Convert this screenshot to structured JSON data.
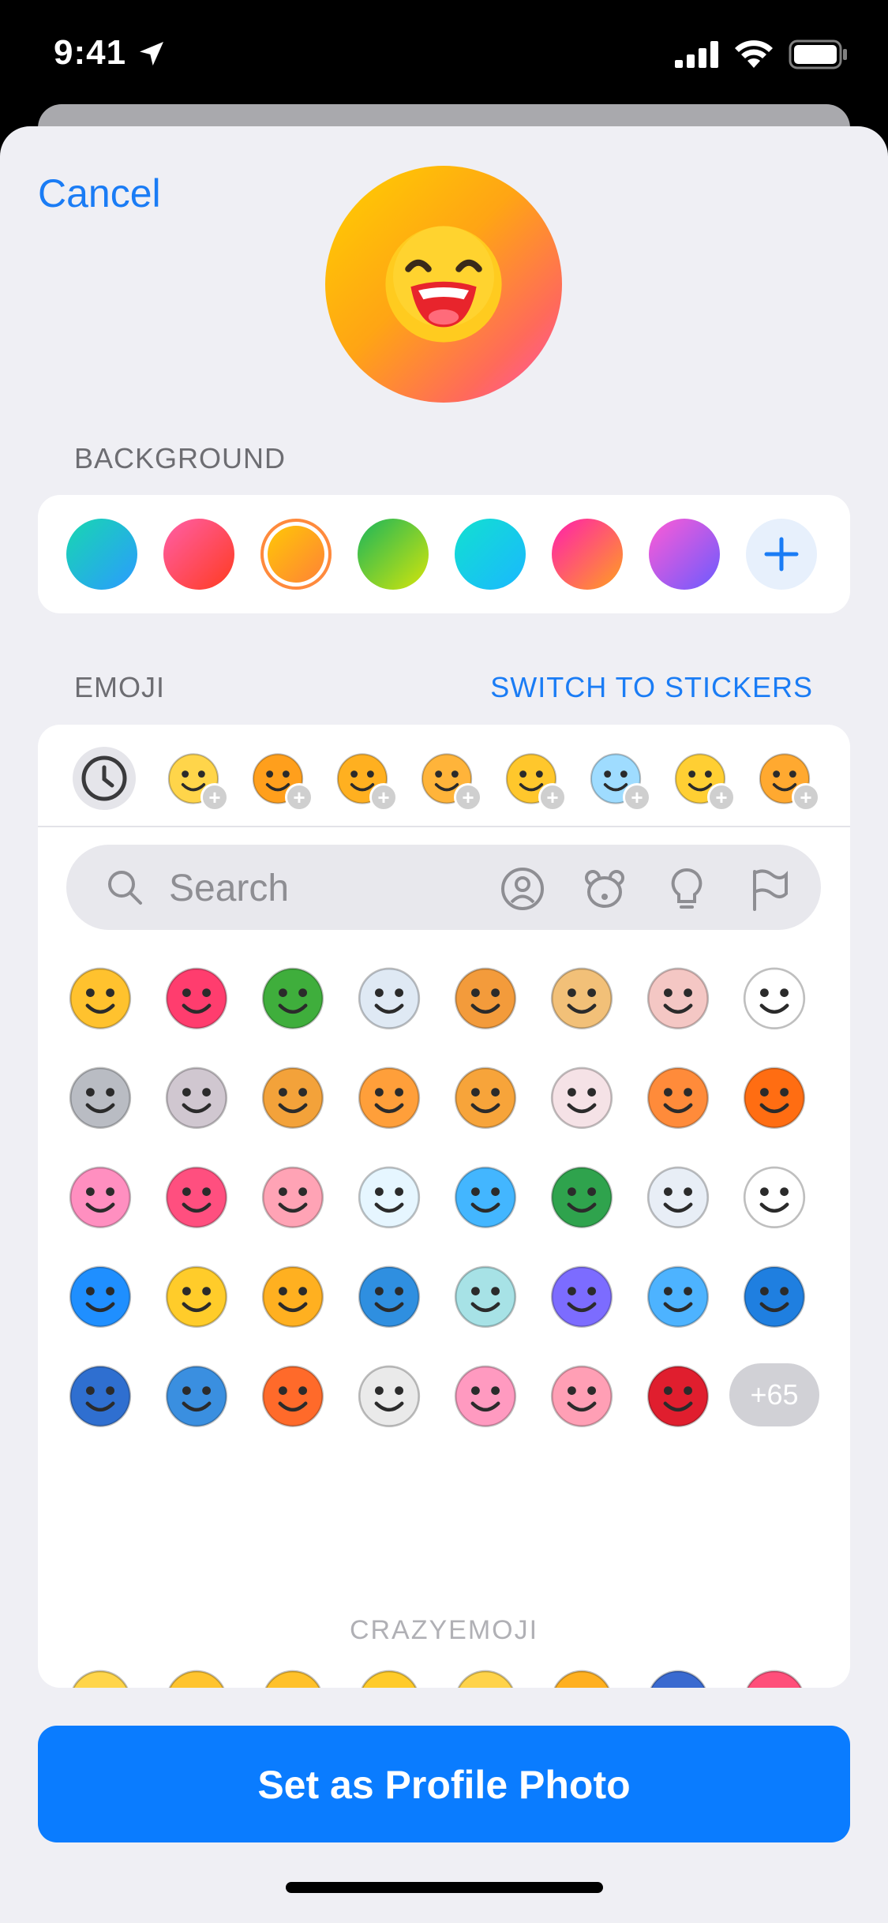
{
  "status_bar": {
    "time": "9:41"
  },
  "sheet": {
    "cancel_label": "Cancel",
    "background_section": "BACKGROUND",
    "emoji_section": "EMOJI",
    "switch_label": "SWITCH TO STICKERS",
    "search": {
      "placeholder": "Search"
    },
    "more_count": "+65",
    "pack_title": "CRAZYEMOJI",
    "primary_button": "Set as Profile Photo"
  },
  "background_swatches": [
    {
      "name": "ocean",
      "colors": [
        "#18d7b0",
        "#2b9bff"
      ]
    },
    {
      "name": "sunset",
      "colors": [
        "#ff5fa8",
        "#ff3b1f"
      ]
    },
    {
      "name": "amber",
      "colors": [
        "#ffd000",
        "#ff7a3c"
      ],
      "selected": true
    },
    {
      "name": "lime",
      "colors": [
        "#1ab55b",
        "#d5e50a"
      ]
    },
    {
      "name": "cyan",
      "colors": [
        "#12e0d0",
        "#1ab8ff"
      ]
    },
    {
      "name": "magenta",
      "colors": [
        "#ff1fae",
        "#ffa020"
      ]
    },
    {
      "name": "violet",
      "colors": [
        "#ff5bd5",
        "#6a5bff"
      ]
    }
  ],
  "recent_emoji": [
    {
      "name": "masked-face",
      "color": "#ffd54a"
    },
    {
      "name": "gg-letters",
      "color": "#ff9f1c"
    },
    {
      "name": "dizzy-face",
      "color": "#ffb020"
    },
    {
      "name": "grin-face",
      "color": "#ffb43a"
    },
    {
      "name": "wink-tongue",
      "color": "#ffc72c"
    },
    {
      "name": "frozen-face",
      "color": "#9fdcff"
    },
    {
      "name": "letter-a-balloon",
      "color": "#ffcf33"
    },
    {
      "name": "kiss-face",
      "color": "#ffa930"
    }
  ],
  "emoji_grid": [
    [
      "#ffc22e",
      "#ff3d6e",
      "#3fae3c",
      "#dfe9f4",
      "#f39b3b",
      "#f2c078",
      "#f4c7c4",
      "#ffffff"
    ],
    [
      "#b9bcc3",
      "#d0c7d0",
      "#f3a23a",
      "#ff9f3a",
      "#f7a43a",
      "#f5e2e6",
      "#ff8b3a",
      "#ff6d12"
    ],
    [
      "#ff8fc0",
      "#ff4f7f",
      "#ffa3b5",
      "#e6f6ff",
      "#43b6ff",
      "#2fa34d",
      "#e8eef6",
      "#ffffff"
    ],
    [
      "#1f8fff",
      "#ffcc2a",
      "#ffb020",
      "#2f8fe0",
      "#a7e2e6",
      "#7c6cff",
      "#4db3ff",
      "#1f7fe0"
    ],
    [
      "#2f6fd0",
      "#3a8fe0",
      "#ff6a2a",
      "#eaeaea",
      "#ff9ac0",
      "#ff9fb5",
      "#e01e2e"
    ]
  ],
  "crazy_emoji": [
    [
      "#ffd54a",
      "#ffc42e",
      "#ffc12a",
      "#ffcb2a",
      "#ffd34a",
      "#ffb020",
      "#3a6ad0",
      "#ff4f7a"
    ],
    [
      "#ffcf33",
      "#ffcc2a",
      "#8fb7ff",
      "#ffd34a",
      "#ff3b4a",
      "#ffc72c",
      "#ffb020",
      "#ffc72c"
    ]
  ]
}
